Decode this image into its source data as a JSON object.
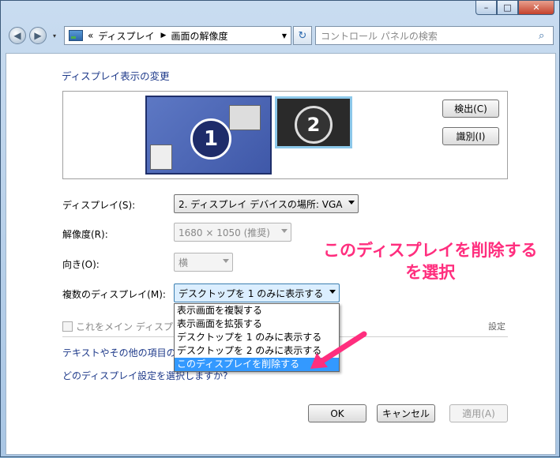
{
  "window": {
    "min": "–",
    "max": "□",
    "close": "✕"
  },
  "nav": {
    "back": "◀",
    "forward": "▶",
    "dropdown": "▾",
    "breadcrumb_prefix": "«",
    "crumb1": "ディスプレイ",
    "sep": "▶",
    "crumb2": "画面の解像度",
    "addr_dd": "▼",
    "refresh": "↻",
    "search_placeholder": "コントロール パネルの検索",
    "search_icon": "⌕"
  },
  "heading": "ディスプレイ表示の変更",
  "preview": {
    "mon1": "1",
    "mon2": "2",
    "detect": "検出(C)",
    "identify": "識別(I)"
  },
  "form": {
    "display_label": "ディスプレイ(S):",
    "display_value": "2. ディスプレイ デバイスの場所: VGA",
    "resolution_label": "解像度(R):",
    "resolution_value": "1680 × 1050 (推奨)",
    "orientation_label": "向き(O):",
    "orientation_value": "横",
    "multi_label": "複数のディスプレイ(M):",
    "multi_value": "デスクトップを 1 のみに表示する"
  },
  "dropdown": {
    "options": [
      "表示画面を複製する",
      "表示画面を拡張する",
      "デスクトップを 1 のみに表示する",
      "デスクトップを 2 のみに表示する",
      "このディスプレイを削除する"
    ]
  },
  "checkbox_label": "これをメイン ディスプレイ",
  "checkbox_tail": "設定",
  "links": {
    "text_size": "テキストやその他の項目の",
    "which_settings": "どのディスプレイ設定を選択しますか?"
  },
  "annotation": {
    "line1": "このディスプレイを削除する",
    "line2": "を選択"
  },
  "buttons": {
    "ok": "OK",
    "cancel": "キャンセル",
    "apply": "適用(A)"
  },
  "colors": {
    "annotation": "#ff2e7e",
    "selected": "#3399ff",
    "link": "#1e3a8a"
  }
}
